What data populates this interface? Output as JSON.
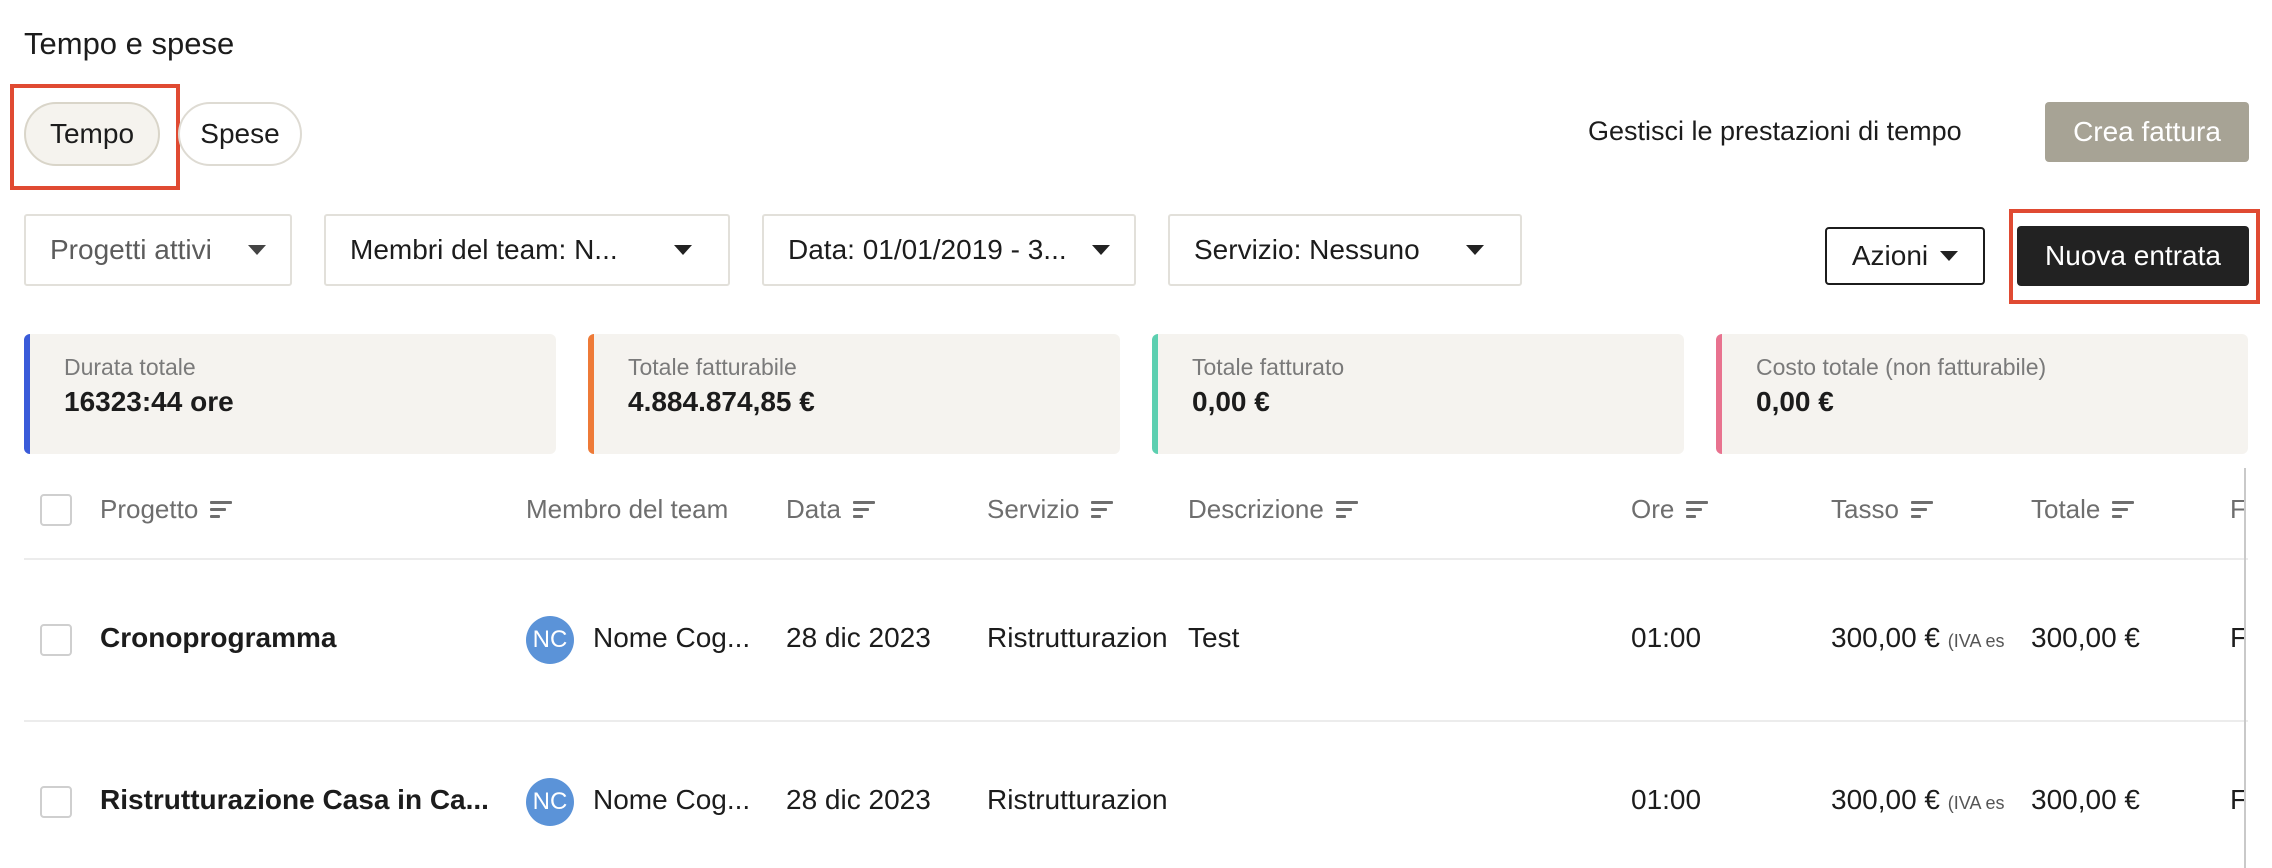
{
  "page": {
    "title": "Tempo e spese"
  },
  "tabs": [
    {
      "label": "Tempo",
      "active": true
    },
    {
      "label": "Spese",
      "active": false
    }
  ],
  "header": {
    "manage_link": "Gestisci le prestazioni di tempo",
    "create_invoice": "Crea fattura"
  },
  "filters": {
    "projects": "Progetti attivi",
    "team_members": "Membri del team: N...",
    "date": "Data: 01/01/2019 - 3...",
    "service": "Servizio: Nessuno"
  },
  "actions": {
    "label": "Azioni",
    "new_entry": "Nuova entrata"
  },
  "stats": [
    {
      "label": "Durata totale",
      "value": "16323:44 ore",
      "color": "#3a5bd9"
    },
    {
      "label": "Totale fatturabile",
      "value": "4.884.874,85 €",
      "color": "#ee7a37"
    },
    {
      "label": "Totale fatturato",
      "value": "0,00 €",
      "color": "#5ccfb0"
    },
    {
      "label": "Costo totale (non fatturabile)",
      "value": "0,00 €",
      "color": "#e8728f"
    }
  ],
  "table": {
    "columns": [
      "Progetto",
      "Membro del team",
      "Data",
      "Servizio",
      "Descrizione",
      "Ore",
      "Tasso",
      "Totale",
      "F"
    ],
    "rows": [
      {
        "project": "Cronoprogramma",
        "avatar": "NC",
        "member": "Nome Cog...",
        "date": "28 dic 2023",
        "service": "Ristrutturazion",
        "description": "Test",
        "hours": "01:00",
        "rate": "300,00 €",
        "rate_note": "(IVA es",
        "total": "300,00 €",
        "extra": "F"
      },
      {
        "project": "Ristrutturazione Casa in Ca...",
        "avatar": "NC",
        "member": "Nome Cog...",
        "date": "28 dic 2023",
        "service": "Ristrutturazion",
        "description": "",
        "hours": "01:00",
        "rate": "300,00 €",
        "rate_note": "(IVA es",
        "total": "300,00 €",
        "extra": "F"
      }
    ]
  },
  "colors": {
    "highlight": "#e04a32",
    "primary_button": "#222222",
    "invoice_button": "#a7a395",
    "avatar": "#5b93d8"
  }
}
